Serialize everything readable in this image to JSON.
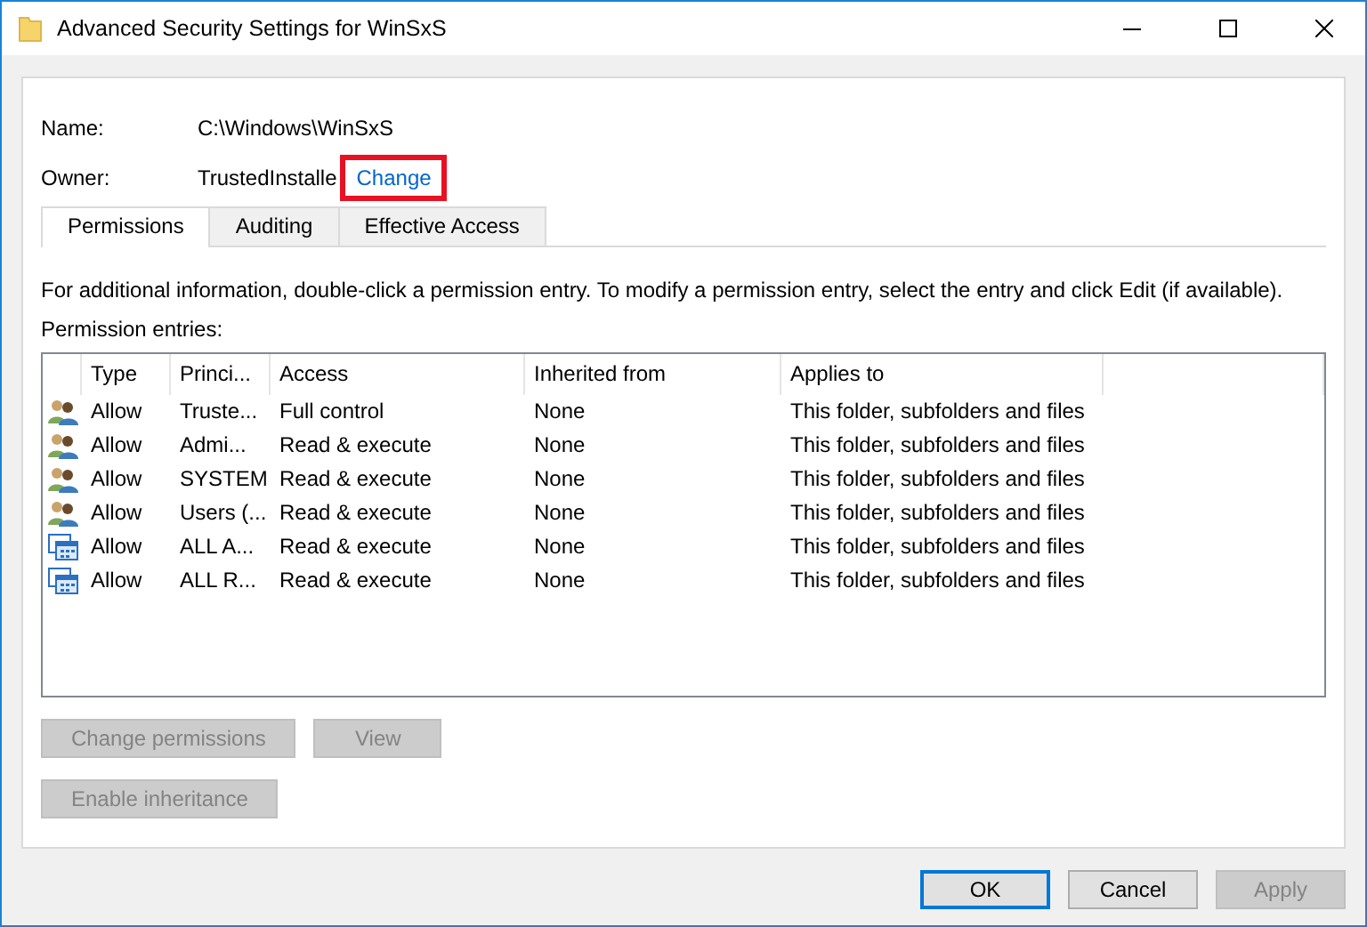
{
  "window": {
    "title": "Advanced Security Settings for WinSxS"
  },
  "fields": [
    {
      "label": "Name:",
      "value": "C:\\Windows\\WinSxS"
    },
    {
      "label": "Owner:",
      "value": "TrustedInstalle",
      "link": "Change",
      "highlighted": true
    }
  ],
  "tabs": [
    {
      "label": "Permissions",
      "selected": true
    },
    {
      "label": "Auditing",
      "selected": false
    },
    {
      "label": "Effective Access",
      "selected": false
    }
  ],
  "info": "For additional information, double-click a permission entry. To modify a permission entry, select the entry and click Edit (if available).",
  "entries_label": "Permission entries:",
  "table": {
    "columns": [
      "Type",
      "Princi...",
      "Access",
      "Inherited from",
      "Applies to"
    ],
    "rows": [
      {
        "kind": "group",
        "cells": [
          "Allow",
          "Truste...",
          "Full control",
          "None",
          "This folder, subfolders and files"
        ]
      },
      {
        "kind": "group",
        "cells": [
          "Allow",
          "Admi...",
          "Read & execute",
          "None",
          "This folder, subfolders and files"
        ]
      },
      {
        "kind": "group",
        "cells": [
          "Allow",
          "SYSTEM",
          "Read & execute",
          "None",
          "This folder, subfolders and files"
        ]
      },
      {
        "kind": "group",
        "cells": [
          "Allow",
          "Users (...",
          "Read & execute",
          "None",
          "This folder, subfolders and files"
        ]
      },
      {
        "kind": "package",
        "cells": [
          "Allow",
          "ALL A...",
          "Read & execute",
          "None",
          "This folder, subfolders and files"
        ]
      },
      {
        "kind": "package",
        "cells": [
          "Allow",
          "ALL R...",
          "Read & execute",
          "None",
          "This folder, subfolders and files"
        ]
      }
    ]
  },
  "actions": [
    {
      "label": "Change permissions",
      "disabled": true
    },
    {
      "label": "View",
      "disabled": true
    }
  ],
  "inheritance_button": {
    "label": "Enable inheritance",
    "disabled": true
  },
  "dialog_buttons": [
    {
      "label": "OK",
      "disabled": false,
      "default": true
    },
    {
      "label": "Cancel",
      "disabled": false,
      "default": false
    },
    {
      "label": "Apply",
      "disabled": true,
      "default": false
    }
  ]
}
